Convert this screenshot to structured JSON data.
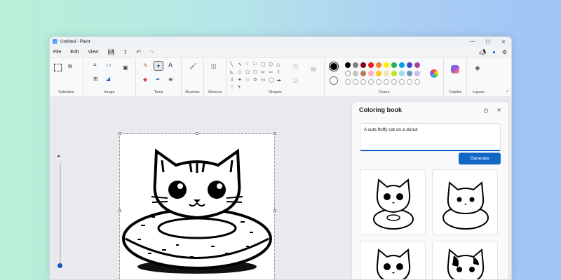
{
  "window": {
    "title": "Untitled - Paint",
    "minimize": "—",
    "maximize": "☐",
    "close": "✕"
  },
  "menu": {
    "file": "File",
    "edit": "Edit",
    "view": "View"
  },
  "ribbon": {
    "groups": {
      "selection": "Selection",
      "image": "Image",
      "tools": "Tools",
      "brushes": "Brushes",
      "stickers": "Stickers",
      "shapes": "Shapes",
      "colors": "Colors",
      "copilot": "Copilot",
      "layers": "Layers"
    },
    "tools_text_icon": "A",
    "palette": [
      "#000000",
      "#7f7f7f",
      "#880015",
      "#ed1c24",
      "#ff7f27",
      "#fff200",
      "#22b14c",
      "#00a2e8",
      "#3f48cc",
      "#a349a4",
      "#ffffff",
      "#c3c3c3",
      "#b97a57",
      "#ffaec9",
      "#ffc90e",
      "#efe4b0",
      "#b5e61d",
      "#99d9ea",
      "#7092be",
      "#c8bfe7"
    ],
    "primary_color": "#000000",
    "secondary_color": "#ffffff"
  },
  "panel": {
    "title": "Coloring book",
    "prompt": "A cute fluffy cat on a donut",
    "generate": "Generate"
  },
  "colors": {
    "accent": "#1167c8",
    "slider": "#0a5cbd"
  }
}
